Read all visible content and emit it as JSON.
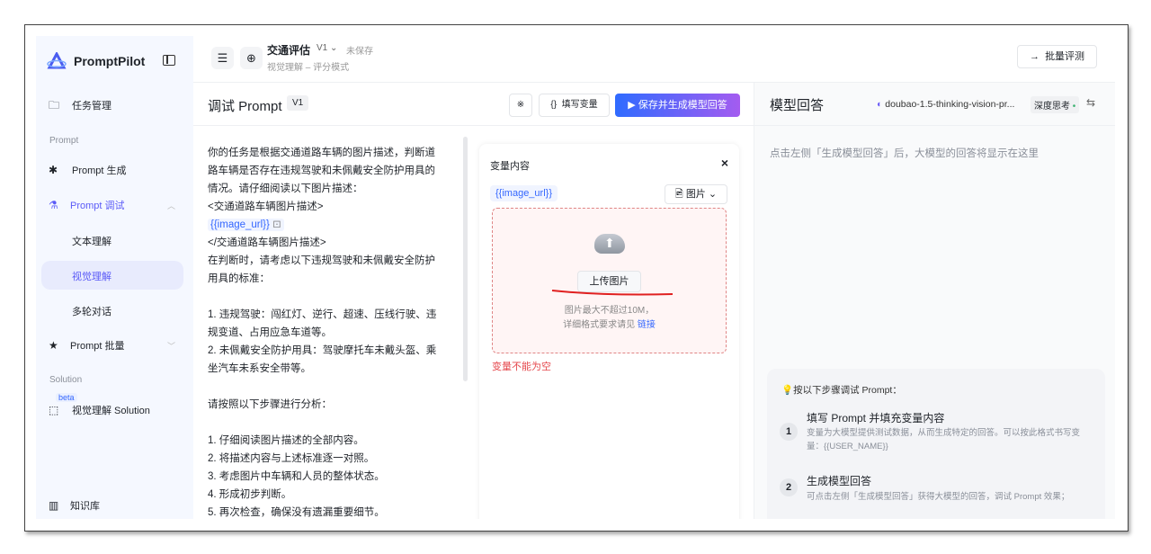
{
  "app": {
    "name": "PromptPilot"
  },
  "sidebar": {
    "task": "任务管理",
    "section_prompt": "Prompt",
    "prompt_gen": "Prompt 生成",
    "prompt_debug": "Prompt 调试",
    "sub_items": [
      "文本理解",
      "视觉理解",
      "多轮对话"
    ],
    "prompt_batch": "Prompt 批量",
    "section_solution": "Solution",
    "beta": "beta",
    "solution_item": "视觉理解 Solution",
    "kb": "知识库"
  },
  "header": {
    "title": "交通评估",
    "version": "V1",
    "status": "未保存",
    "subtitle": "视觉理解 – 评分模式",
    "batch_eval": "批量评测"
  },
  "debug": {
    "title": "调试 Prompt",
    "version": "V1",
    "fill_vars": "填写变量",
    "save_gen": "保存并生成模型回答",
    "prompt_lines_a": "你的任务是根据交通道路车辆的图片描述，判断道路车辆是否存在违规驾驶和未佩戴安全防护用具的情况。请仔细阅读以下图片描述：\n<交通道路车辆图片描述>",
    "prompt_var": "{{image_url}}",
    "prompt_lines_b": "</交通道路车辆图片描述>\n在判断时，请考虑以下违规驾驶和未佩戴安全防护用具的标准：\n\n1. 违规驾驶：闯红灯、逆行、超速、压线行驶、违规变道、占用应急车道等。\n2. 未佩戴安全防护用具：驾驶摩托车未戴头盔、乘坐汽车未系安全带等。\n\n请按照以下步骤进行分析：\n\n1. 仔细阅读图片描述的全部内容。\n2. 将描述内容与上述标准逐一对照。\n3. 考虑图片中车辆和人员的整体状态。\n4. 形成初步判断。\n5. 再次检查，确保没有遗漏重要细节。"
  },
  "variables": {
    "title": "变量内容",
    "close": "×",
    "var_name": "{{image_url}}",
    "type": "图片",
    "upload": "上传图片",
    "hint1": "图片最大不超过10M，",
    "hint2": "详细格式要求请见",
    "link": "链接",
    "error": "变量不能为空",
    "error_color": "#e5484d"
  },
  "response": {
    "title": "模型回答",
    "model": "doubao-1.5-thinking-vision-pr...",
    "deep_think": "深度思考",
    "placeholder": "点击左侧「生成模型回答」后，大模型的回答将显示在这里",
    "tips_title": "按以下步骤调试 Prompt：",
    "steps": [
      {
        "n": "1",
        "title": "填写 Prompt 并填充变量内容",
        "desc": "变量为大模型提供测试数据，从而生成特定的回答。可以按此格式书写变量：{{USER_NAME}}"
      },
      {
        "n": "2",
        "title": "生成模型回答",
        "desc": "可点击左侧「生成模型回答」获得大模型的回答，调试 Prompt 效果；"
      }
    ]
  },
  "colors": {
    "accent": "#5b5bf7",
    "primary_blue": "#3366ff"
  }
}
